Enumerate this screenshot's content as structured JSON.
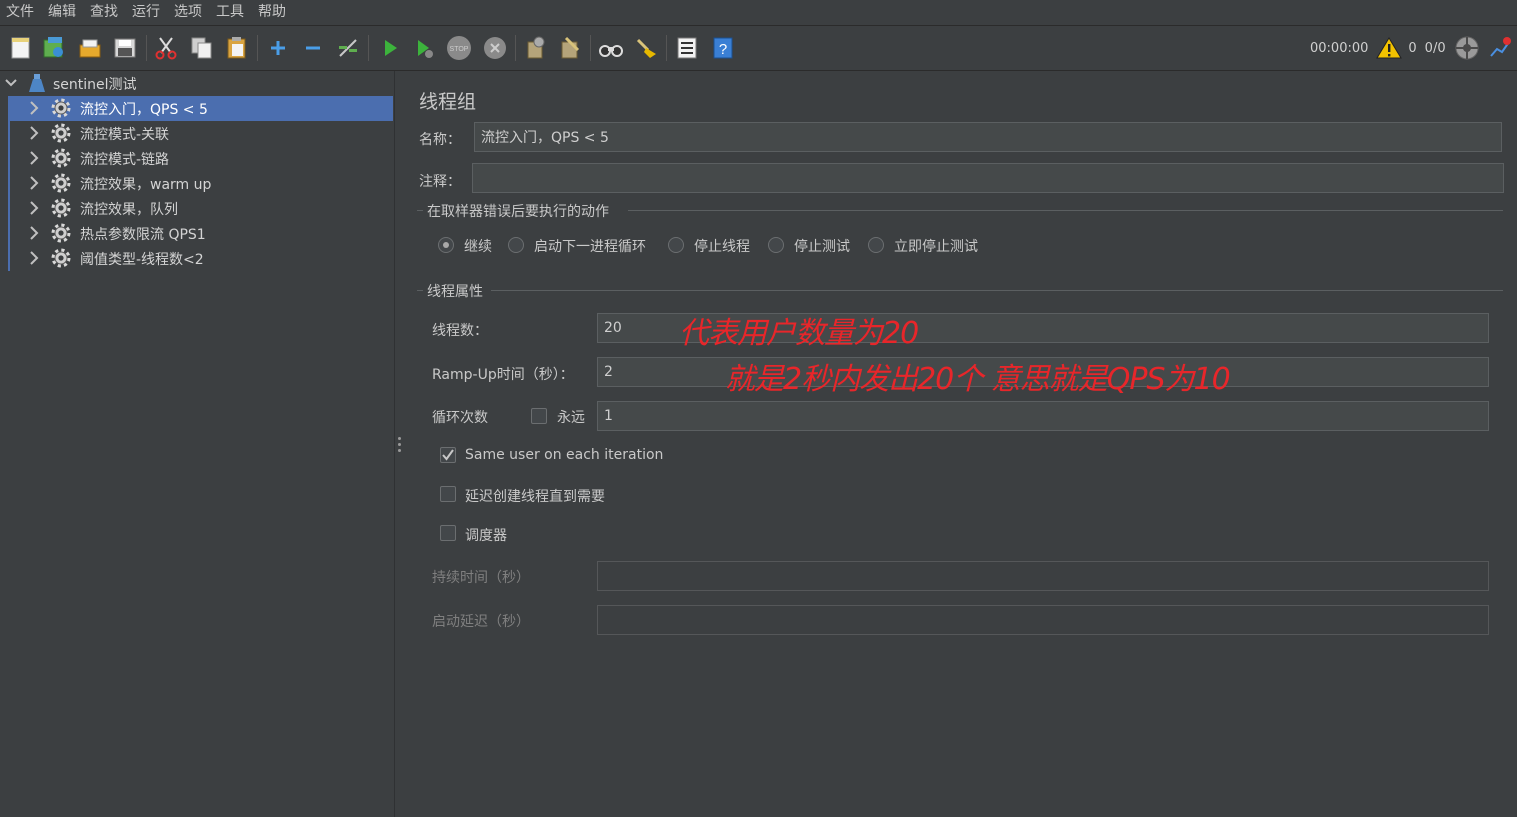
{
  "menu": [
    "文件",
    "编辑",
    "查找",
    "运行",
    "选项",
    "工具",
    "帮助"
  ],
  "toolbar": {
    "icons": [
      "new-icon",
      "templates-icon",
      "open-icon",
      "save-icon",
      "cut-icon",
      "copy-icon",
      "paste-icon",
      "expand-icon",
      "collapse-icon",
      "toggle-icon",
      "start-icon",
      "start-no-pause-icon",
      "stop-icon",
      "shutdown-icon",
      "clear-icon",
      "clear-all-icon",
      "search-icon",
      "reset-search-icon",
      "function-helper-icon",
      "help-icon"
    ],
    "timer": "00:00:00",
    "warnings": "0",
    "threads": "0/0"
  },
  "tree": {
    "root": "sentinel测试",
    "items": [
      "流控入门，QPS < 5",
      "流控模式-关联",
      "流控模式-链路",
      "流控效果，warm up",
      "流控效果，队列",
      "热点参数限流 QPS1",
      "阈值类型-线程数<2"
    ]
  },
  "panel": {
    "title": "线程组",
    "name_label": "名称：",
    "name_value": "流控入门，QPS < 5",
    "comment_label": "注释：",
    "comment_value": "",
    "error_group": "在取样器错误后要执行的动作",
    "error_options": [
      "继续",
      "启动下一进程循环",
      "停止线程",
      "停止测试",
      "立即停止测试"
    ],
    "thread_group": "线程属性",
    "threads_label": "线程数：",
    "threads_value": "20",
    "rampup_label": "Ramp-Up时间（秒）：",
    "rampup_value": "2",
    "loop_label": "循环次数",
    "forever_label": "永远",
    "loop_value": "1",
    "same_user_label": "Same user on each iteration",
    "delay_label": "延迟创建线程直到需要",
    "scheduler_label": "调度器",
    "duration_label": "持续时间（秒）",
    "startup_delay_label": "启动延迟（秒）"
  },
  "annotations": {
    "line1": "代表用户数量为20",
    "line2": "就是2秒内发出20个 意思就是QPS为10"
  },
  "colors": {
    "selection": "#4b6eaf",
    "annotation": "#e8262a",
    "background": "#3c3f41"
  }
}
